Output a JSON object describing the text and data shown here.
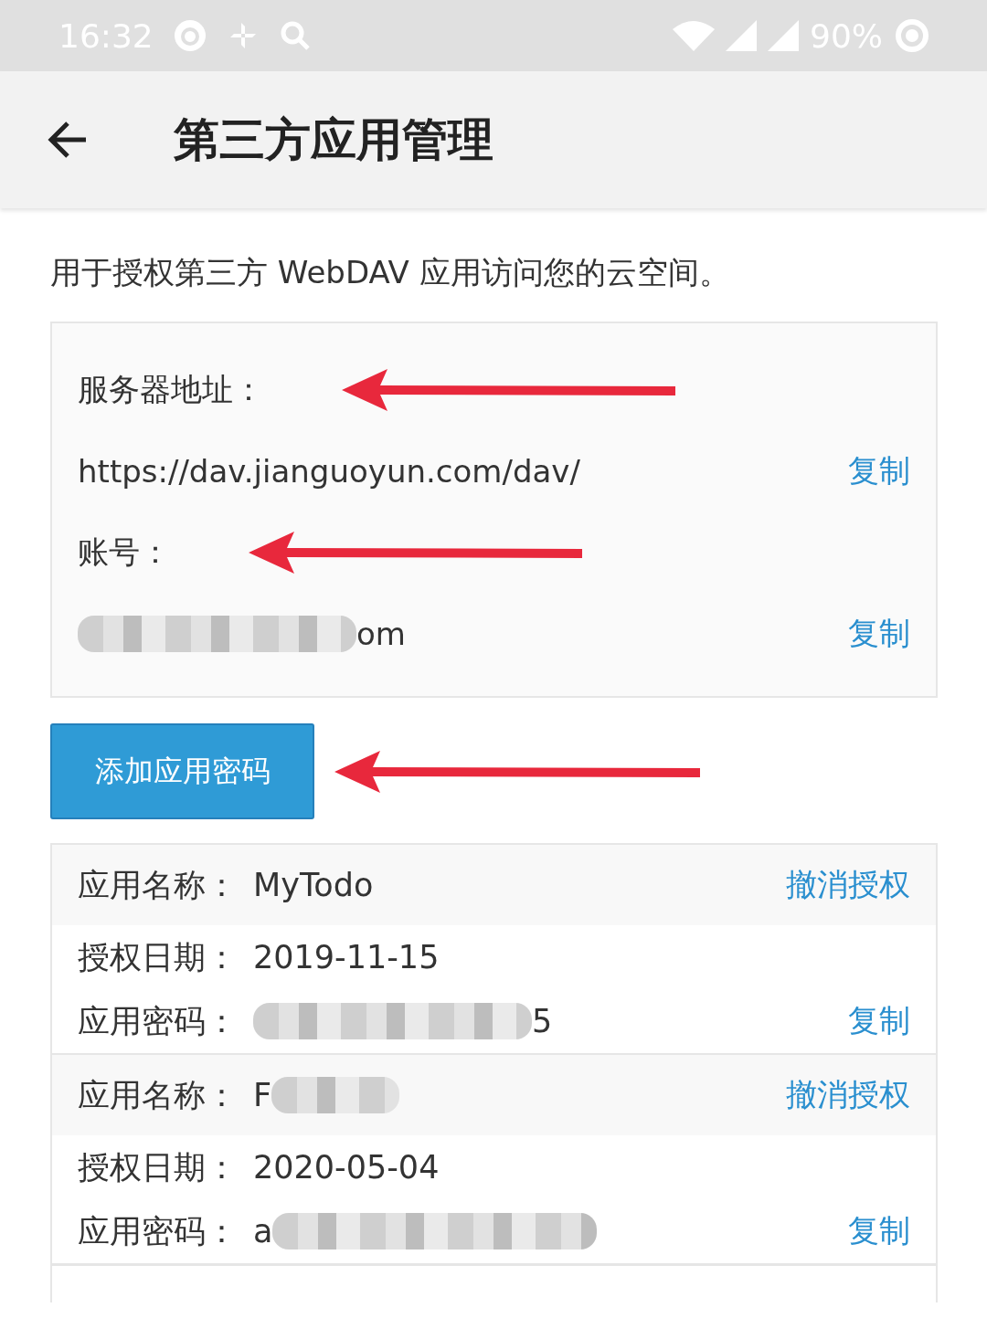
{
  "status_bar": {
    "time": "16:32",
    "battery": "90%"
  },
  "app_bar": {
    "title": "第三方应用管理"
  },
  "description": "用于授权第三方 WebDAV 应用访问您的云空间。",
  "server_card": {
    "rows": [
      {
        "kind": "label",
        "text": "服务器地址：",
        "arrow": true
      },
      {
        "kind": "value",
        "text": "https://dav.jianguoyun.com/dav/",
        "action": "复制"
      },
      {
        "kind": "label",
        "text": "账号：",
        "arrow": true
      },
      {
        "kind": "value",
        "text": "om",
        "redacted_before": true,
        "action": "复制"
      }
    ]
  },
  "add_button": {
    "label": "添加应用密码",
    "arrow": true
  },
  "apps": [
    {
      "fields": [
        {
          "label": "应用名称：",
          "value": "MyTodo",
          "action": "撤消授权"
        },
        {
          "label": "授权日期：",
          "value": "2019-11-15"
        },
        {
          "label": "应用密码：",
          "value": "5",
          "redacted_before": true,
          "action": "复制"
        }
      ]
    },
    {
      "fields": [
        {
          "label": "应用名称：",
          "value": "F",
          "redacted_after": true,
          "action": "撤消授权"
        },
        {
          "label": "授权日期：",
          "value": "2020-05-04"
        },
        {
          "label": "应用密码：",
          "value": "a",
          "redacted_after": true,
          "action": "复制"
        }
      ]
    }
  ]
}
